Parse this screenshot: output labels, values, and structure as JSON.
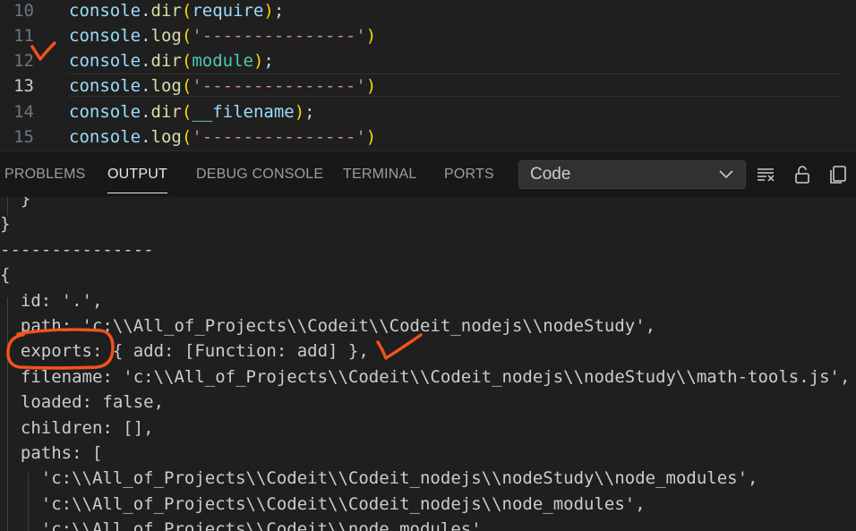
{
  "editor": {
    "current_line": "13",
    "lines": [
      {
        "no": "10",
        "obj": "console",
        "dot": ".",
        "fn": "dir",
        "open": "(",
        "arg": "require",
        "close": ")",
        "semi": ";"
      },
      {
        "no": "11",
        "obj": "console",
        "dot": ".",
        "fn": "log",
        "open": "(",
        "arg": "'---------------'",
        "close": ")",
        "semi": ""
      },
      {
        "no": "12",
        "obj": "console",
        "dot": ".",
        "fn": "dir",
        "open": "(",
        "arg": "module",
        "close": ")",
        "semi": ";"
      },
      {
        "no": "13",
        "obj": "console",
        "dot": ".",
        "fn": "log",
        "open": "(",
        "arg": "'---------------'",
        "close": ")",
        "semi": ""
      },
      {
        "no": "14",
        "obj": "console",
        "dot": ".",
        "fn": "dir",
        "open": "(",
        "arg": "__filename",
        "close": ")",
        "semi": ";"
      },
      {
        "no": "15",
        "obj": "console",
        "dot": ".",
        "fn": "log",
        "open": "(",
        "arg": "'---------------'",
        "close": ")",
        "semi": ""
      }
    ]
  },
  "panel": {
    "tabs": [
      {
        "label": "PROBLEMS"
      },
      {
        "label": "OUTPUT"
      },
      {
        "label": "DEBUG CONSOLE"
      },
      {
        "label": "TERMINAL"
      },
      {
        "label": "PORTS"
      }
    ],
    "active_tab": "OUTPUT",
    "channel": "Code",
    "icons": [
      "clear-output-icon",
      "lock-icon",
      "copy-icon"
    ]
  },
  "output": {
    "lines": [
      "  }",
      "}",
      "---------------",
      "{",
      "  id: '.',",
      "  path: 'c:\\\\All_of_Projects\\\\Codeit\\\\Codeit_nodejs\\\\nodeStudy',",
      "  exports: { add: [Function: add] },",
      "  filename: 'c:\\\\All_of_Projects\\\\Codeit\\\\Codeit_nodejs\\\\nodeStudy\\\\math-tools.js',",
      "  loaded: false,",
      "  children: [],",
      "  paths: [",
      "    'c:\\\\All_of_Projects\\\\Codeit\\\\Codeit_nodejs\\\\nodeStudy\\\\node_modules',",
      "    'c:\\\\All_of_Projects\\\\Codeit\\\\Codeit_nodejs\\\\node_modules',",
      "    'c:\\\\All_of_Projects\\\\Codeit\\\\node_modules',"
    ]
  },
  "colors": {
    "background": "#1f1f1f",
    "panel_bar": "#181818",
    "annotation": "#f4511e"
  }
}
